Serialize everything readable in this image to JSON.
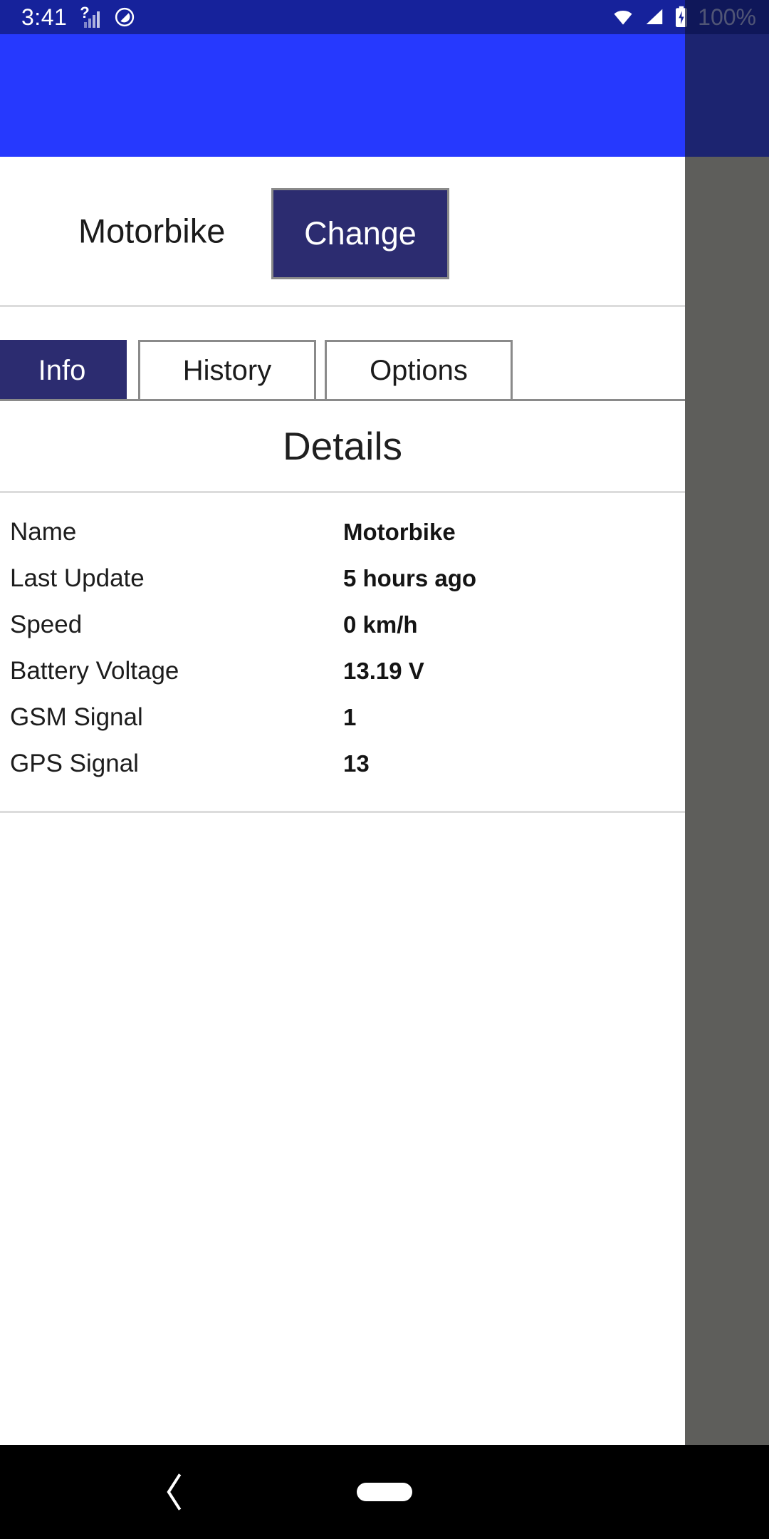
{
  "status_bar": {
    "time": "3:41",
    "battery_percent": "100%",
    "icons": [
      "sim-unknown-signal-icon",
      "do-not-disturb-icon",
      "wifi-icon",
      "cellular-signal-icon",
      "battery-charging-icon"
    ],
    "background_color": "#16229b"
  },
  "app": {
    "header": {
      "background_color": "#2639fe"
    },
    "title_row": {
      "device_name": "Motorbike",
      "change_button_label": "Change",
      "change_button_color": "#2c2c70"
    },
    "tabs": [
      {
        "label": "Info",
        "selected": true
      },
      {
        "label": "History",
        "selected": false
      },
      {
        "label": "Options",
        "selected": false
      }
    ],
    "details": {
      "heading": "Details",
      "rows": [
        {
          "key": "Name",
          "value": "Motorbike"
        },
        {
          "key": "Last Update",
          "value": "5 hours ago"
        },
        {
          "key": "Speed",
          "value": "0 km/h"
        },
        {
          "key": "Battery Voltage",
          "value": "13.19 V"
        },
        {
          "key": "GSM Signal",
          "value": "1"
        },
        {
          "key": "GPS Signal",
          "value": "13"
        }
      ]
    }
  },
  "navigation_bar": {
    "back_icon": "chevron-left-icon",
    "home_icon": "home-pill-icon",
    "background_color": "#000000"
  }
}
